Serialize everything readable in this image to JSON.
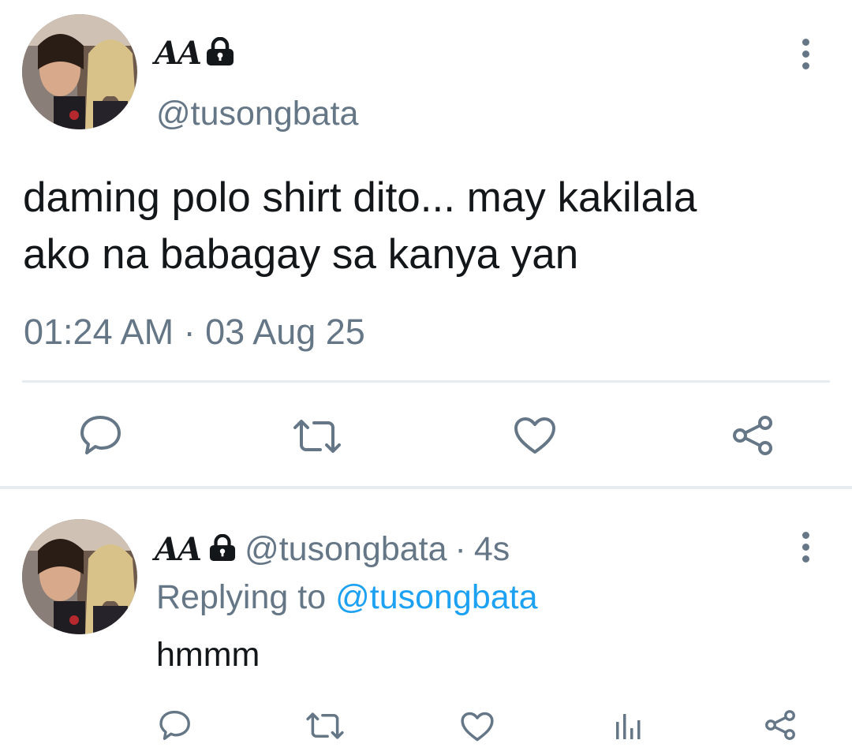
{
  "main_tweet": {
    "display_name": "AA",
    "handle": "@tusongbata",
    "text_line1": "daming polo shirt dito... may kakilala",
    "text_line2": "ako na babagay sa kanya yan",
    "timestamp": "01:24 AM · 03 Aug 25",
    "actions": [
      "reply-icon",
      "retweet-icon",
      "like-icon",
      "share-icon"
    ]
  },
  "reply": {
    "display_name": "AA",
    "handle": "@tusongbata",
    "separator": "·",
    "age": "4s",
    "replying_prefix": "Replying to",
    "replying_to": "@tusongbata",
    "text": "hmmm",
    "actions": [
      "reply-icon",
      "retweet-icon",
      "like-icon",
      "analytics-icon",
      "share-icon"
    ]
  },
  "colors": {
    "muted": "#657786",
    "link": "#1da1f2",
    "text": "#14171a",
    "divider": "#e6ecf0"
  }
}
